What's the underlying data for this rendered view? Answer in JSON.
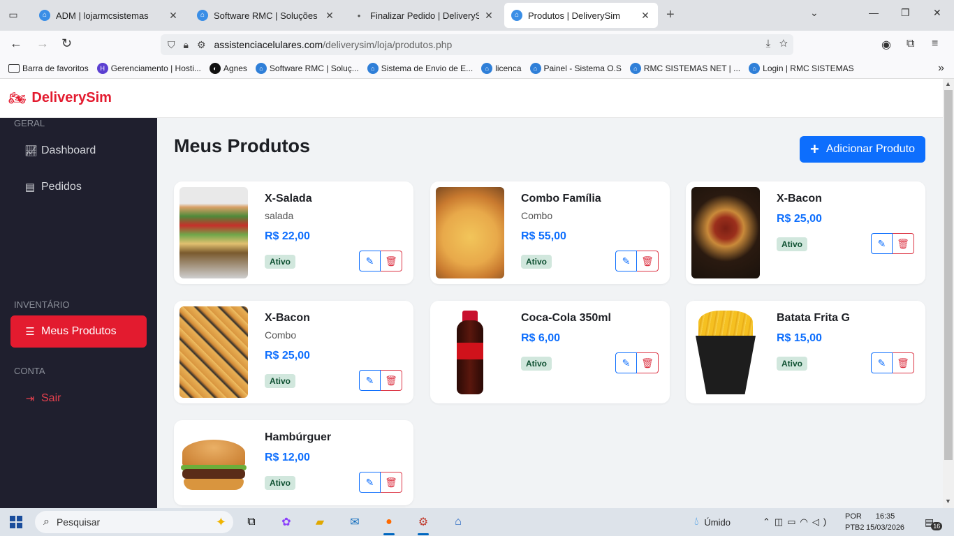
{
  "browser": {
    "tabs": [
      {
        "title": "ADM | lojarmcsistemas",
        "active": false
      },
      {
        "title": "Software RMC | Soluções Digita",
        "active": false
      },
      {
        "title": "Finalizar Pedido | DeliverySim",
        "active": false
      },
      {
        "title": "Produtos | DeliverySim",
        "active": true
      }
    ],
    "url_host": "assistenciacelulares.com",
    "url_path": "/deliverysim/loja/produtos.php",
    "bookmarks": [
      "Barra de favoritos",
      "Gerenciamento | Hosti...",
      "Agnes",
      "Software RMC | Soluç...",
      "Sistema de Envio de E...",
      "licenca",
      "Painel - Sistema O.S",
      "RMC SISTEMAS NET | ...",
      "Login | RMC SISTEMAS"
    ]
  },
  "app": {
    "brand": "DeliverySim",
    "accent": "#e31b2f"
  },
  "sidebar": {
    "sections": {
      "geral": "GERAL",
      "inventario": "INVENTÁRIO",
      "conta": "CONTA"
    },
    "items": {
      "dashboard": "Dashboard",
      "pedidos": "Pedidos",
      "meus_produtos": "Meus Produtos",
      "sair": "Sair"
    }
  },
  "main": {
    "title": "Meus Produtos",
    "add_button": "Adicionar Produto",
    "products": [
      {
        "name": "X-Salada",
        "category": "salada",
        "price": "R$ 22,00",
        "status": "Ativo"
      },
      {
        "name": "Combo Família",
        "category": "Combo",
        "price": "R$ 55,00",
        "status": "Ativo"
      },
      {
        "name": "X-Bacon",
        "category": "",
        "price": "R$ 25,00",
        "status": "Ativo"
      },
      {
        "name": "X-Bacon",
        "category": "Combo",
        "price": "R$ 25,00",
        "status": "Ativo"
      },
      {
        "name": "Coca-Cola 350ml",
        "category": "",
        "price": "R$ 6,00",
        "status": "Ativo"
      },
      {
        "name": "Batata Frita G",
        "category": "",
        "price": "R$ 15,00",
        "status": "Ativo"
      },
      {
        "name": "Hambúrguer",
        "category": "",
        "price": "R$ 12,00",
        "status": "Ativo"
      }
    ]
  },
  "taskbar": {
    "search_placeholder": "Pesquisar",
    "weather": "Úmido",
    "lang_1": "POR",
    "lang_2": "PTB2",
    "time": "16:35",
    "date": "15/03/2026",
    "notif_count": "16"
  }
}
